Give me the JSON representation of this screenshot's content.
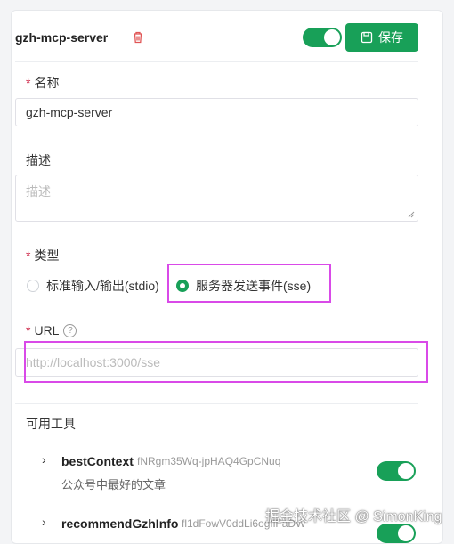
{
  "header": {
    "title": "gzh-mcp-server",
    "save_label": "保存"
  },
  "form": {
    "name_label": "名称",
    "name_value": "gzh-mcp-server",
    "desc_label": "描述",
    "desc_placeholder": "描述",
    "type_label": "类型",
    "type_options": [
      {
        "label": "标准输入/输出(stdio)",
        "selected": false
      },
      {
        "label": "服务器发送事件(sse)",
        "selected": true
      }
    ],
    "url_label": "URL",
    "url_placeholder": "http://localhost:3000/sse",
    "required_mark": "*"
  },
  "tools": {
    "section_label": "可用工具",
    "items": [
      {
        "name": "bestContext",
        "id": "fNRgm35Wq-jpHAQ4GpCNuq",
        "desc": "公众号中最好的文章",
        "enabled": true
      },
      {
        "name": "recommendGzhInfo",
        "id": "fl1dFowV0ddLi6ogflFaDW",
        "desc": "",
        "enabled": true
      }
    ]
  },
  "watermark": "掘金技术社区 @ SimonKing",
  "colors": {
    "accent": "#18a058",
    "required": "#d03050",
    "highlight": "#d94ae8"
  }
}
